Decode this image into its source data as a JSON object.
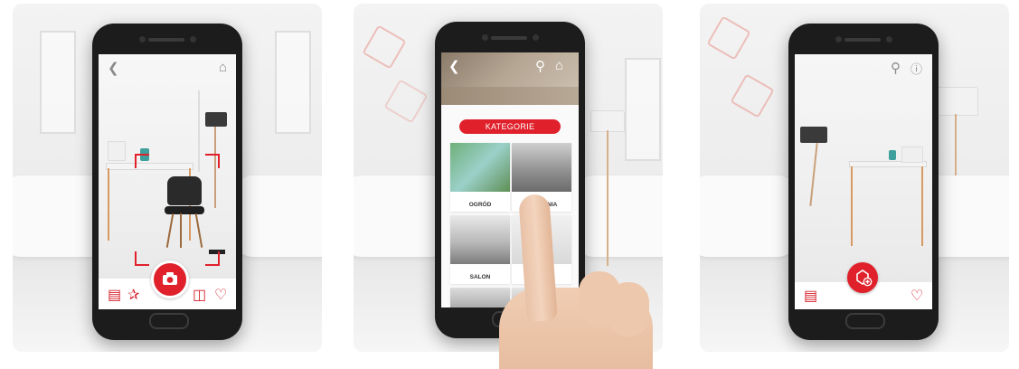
{
  "panels": [
    {
      "icons": {
        "back": "chevron-left-icon",
        "home": "home-icon",
        "camera": "camera-icon",
        "gallery": "gallery-icon",
        "share": "share-icon",
        "basket": "basket-icon",
        "favorite": "heart-icon"
      }
    },
    {
      "categories_label": "KATEGORIE",
      "categories": [
        {
          "label": "OGRÓD"
        },
        {
          "label": "SYPIALNIA"
        },
        {
          "label": "SALON"
        },
        {
          "label": ""
        }
      ],
      "icons": {
        "back": "chevron-left-icon",
        "search": "search-icon",
        "home": "home-icon"
      }
    },
    {
      "icons": {
        "search": "search-icon",
        "info": "info-icon",
        "add_object": "add-object-icon",
        "gallery": "gallery-icon",
        "favorite": "heart-icon"
      }
    }
  ],
  "colors": {
    "accent": "#e0212b",
    "phone": "#1c1c1c"
  }
}
